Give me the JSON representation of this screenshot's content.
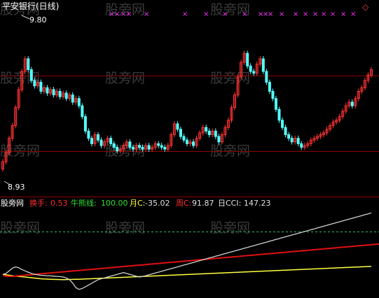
{
  "stock_title": "平安银行(日线)",
  "upper_panel": {
    "high_label": "9.80",
    "low_label": "8.93",
    "ylim": [
      8.9,
      9.86
    ],
    "x_markers": [
      "×",
      "×",
      "×",
      "×",
      "×",
      "×",
      "×",
      "×",
      "×",
      "×",
      "×",
      "×",
      "×",
      "×",
      "×",
      "×",
      "×",
      "×",
      "×",
      "×"
    ],
    "diamond": "◇"
  },
  "indicator_bar": {
    "name": "股旁网",
    "items": [
      {
        "label": "换手:",
        "value": "0.53",
        "label_color": "#ff3030",
        "value_color": "#ff3030"
      },
      {
        "label": "牛熊线:",
        "value": "100.00",
        "label_color": "#30e030",
        "value_color": "#30e030"
      },
      {
        "label": "月C:",
        "value": "-35.02",
        "label_color": "#ffff40",
        "value_color": "#e0e0e0"
      },
      {
        "label": "周C:",
        "value": "91.87",
        "label_color": "#ff3030",
        "value_color": "#e0e0e0"
      },
      {
        "label": "日CCI:",
        "value": "147.23",
        "label_color": "#e0e0e0",
        "value_color": "#e0e0e0"
      }
    ]
  },
  "watermark": "股旁网",
  "colors": {
    "up": "#ff3333",
    "down": "#54ffff",
    "grid": "#8b0000",
    "dash": "#30c060",
    "monthly": "#ffff40",
    "weekly": "#e01010",
    "daily": "#d0d0d0"
  },
  "chart_data": [
    {
      "type": "candlestick",
      "title": "平安银行(日线)",
      "ylim": [
        8.9,
        9.86
      ],
      "annotations": [
        "9.80",
        "8.93"
      ],
      "close": [
        9.05,
        9.1,
        9.18,
        9.25,
        9.35,
        9.45,
        9.55,
        9.62,
        9.56,
        9.5,
        9.47,
        9.49,
        9.44,
        9.46,
        9.43,
        9.45,
        9.42,
        9.44,
        9.41,
        9.43,
        9.4,
        9.42,
        9.38,
        9.4,
        9.36,
        9.3,
        9.22,
        9.18,
        9.15,
        9.2,
        9.17,
        9.14,
        9.16,
        9.18,
        9.15,
        9.13,
        9.11,
        9.12,
        9.14,
        9.16,
        9.13,
        9.12,
        9.14,
        9.13,
        9.12,
        9.14,
        9.12,
        9.13,
        9.15,
        9.14,
        9.13,
        9.12,
        9.14,
        9.2,
        9.26,
        9.23,
        9.19,
        9.17,
        9.15,
        9.16,
        9.14,
        9.18,
        9.21,
        9.24,
        9.22,
        9.2,
        9.22,
        9.19,
        9.16,
        9.2,
        9.24,
        9.28,
        9.35,
        9.42,
        9.52,
        9.6,
        9.65,
        9.58,
        9.55,
        9.54,
        9.59,
        9.62,
        9.55,
        9.49,
        9.44,
        9.4,
        9.34,
        9.28,
        9.24,
        9.2,
        9.18,
        9.16,
        9.18,
        9.15,
        9.13,
        9.14,
        9.15,
        9.17,
        9.18,
        9.19,
        9.2,
        9.21,
        9.23,
        9.25,
        9.27,
        9.28,
        9.3,
        9.33,
        9.36,
        9.38,
        9.36,
        9.4,
        9.44,
        9.46,
        9.5,
        9.53,
        9.56
      ],
      "monthly_cci": [
        80,
        72,
        65,
        58,
        52,
        48,
        45,
        40,
        35,
        30,
        25,
        20,
        15,
        12,
        10,
        8,
        6,
        5,
        4,
        3,
        4,
        5,
        6,
        7,
        8,
        10,
        12,
        14,
        16,
        18,
        20,
        22,
        24,
        26,
        28,
        30,
        32,
        34,
        36,
        38,
        40,
        42,
        44,
        46,
        48,
        50,
        52,
        54,
        56,
        58,
        60,
        62,
        64,
        66,
        68,
        70,
        72,
        74,
        76,
        78,
        80,
        82,
        84,
        86,
        88,
        90,
        92,
        94,
        96,
        98,
        100,
        102,
        104,
        106,
        108,
        110,
        112,
        114,
        116,
        118,
        120,
        122,
        124,
        126,
        128,
        130,
        132,
        134,
        136,
        138,
        140,
        142,
        144,
        146,
        148,
        150,
        152,
        154,
        156,
        158,
        160,
        162,
        164,
        166,
        168,
        170,
        172,
        174,
        176,
        178,
        180,
        182,
        184,
        186,
        188,
        190,
        192
      ],
      "weekly_cci": [
        60,
        55,
        50,
        48,
        52,
        58,
        62,
        66,
        70,
        74,
        78,
        82,
        86,
        90,
        94,
        98,
        102,
        106,
        110,
        114,
        118,
        122,
        126,
        130,
        134,
        138,
        142,
        146,
        150,
        154,
        158,
        162,
        166,
        170,
        174,
        178,
        182,
        186,
        190,
        194,
        198,
        202,
        206,
        210,
        214,
        218,
        222,
        226,
        230,
        234,
        238,
        242,
        246,
        250,
        254,
        258,
        262,
        266,
        270,
        274,
        278,
        282,
        286,
        290,
        294,
        298,
        302,
        306,
        310,
        314,
        318,
        322,
        326,
        330,
        334,
        338,
        342,
        346,
        350,
        354,
        358,
        362,
        366,
        370,
        374,
        378,
        382,
        386,
        390,
        394,
        398,
        402,
        406,
        410,
        414,
        418,
        422,
        426,
        430,
        434,
        438,
        442,
        446,
        450,
        454,
        458,
        462,
        466,
        470,
        474,
        478,
        482,
        486,
        490,
        494,
        498,
        502,
        506,
        510,
        514
      ],
      "daily_cci": [
        40,
        60,
        120,
        180,
        210,
        190,
        150,
        120,
        90,
        60,
        40,
        30,
        20,
        15,
        10,
        5,
        0,
        -5,
        -10,
        -20,
        -40,
        -80,
        -160,
        -260,
        -300,
        -280,
        -240,
        -200,
        -160,
        -120,
        -80,
        -60,
        -40,
        -20,
        0,
        20,
        40,
        60,
        80,
        60,
        40,
        20,
        0,
        -20,
        -10,
        10,
        30,
        50,
        70,
        90,
        110,
        130,
        150,
        170,
        190,
        210,
        230,
        250,
        270,
        290,
        310,
        330,
        350,
        370,
        390,
        410,
        430,
        450,
        470,
        490,
        510,
        530,
        550,
        570,
        590,
        610,
        630,
        650,
        670,
        690,
        710,
        730,
        750,
        770,
        790,
        810,
        830,
        850,
        870,
        890,
        910,
        930,
        950,
        970,
        990,
        1010,
        1030,
        1050,
        1070,
        1090,
        1110,
        1130,
        1150,
        1170,
        1190,
        1210,
        1230,
        1250,
        1270,
        1290,
        1310,
        1330,
        1350,
        1370,
        1390,
        1410,
        1430
      ]
    }
  ]
}
